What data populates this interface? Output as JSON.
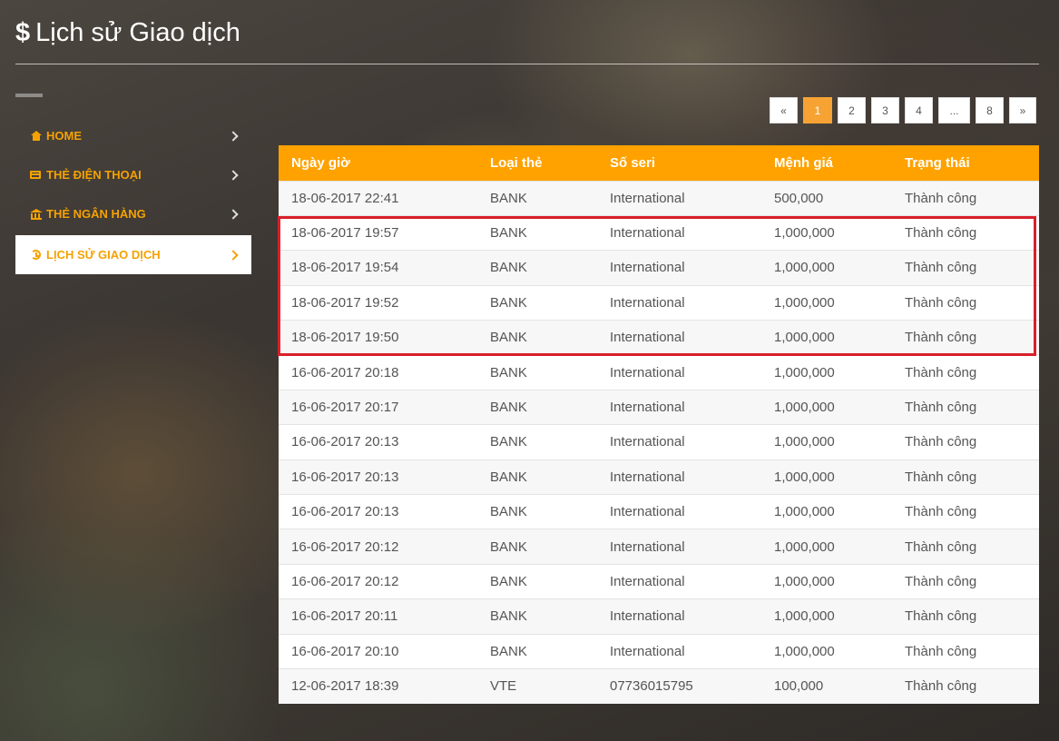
{
  "header": {
    "icon": "dollar-sign",
    "dollar": "$",
    "title": "Lịch sử Giao dịch"
  },
  "sidebar": {
    "items": [
      {
        "label": "HOME",
        "icon": "home-icon",
        "active": false
      },
      {
        "label": "THẺ ĐIỆN THOẠI",
        "icon": "credit-card-icon",
        "active": false
      },
      {
        "label": "THẺ NGÂN HÀNG",
        "icon": "bank-icon",
        "active": false
      },
      {
        "label": "LỊCH SỬ GIAO DỊCH",
        "icon": "history-icon",
        "active": true
      }
    ]
  },
  "pagination": {
    "prev": "«",
    "pages": [
      "1",
      "2",
      "3",
      "4",
      "...",
      "8"
    ],
    "next": "»",
    "current": "1"
  },
  "table": {
    "columns": [
      "Ngày giờ",
      "Loại thẻ",
      "Số seri",
      "Mệnh giá",
      "Trạng thái"
    ],
    "rows": [
      [
        "18-06-2017 22:41",
        "BANK",
        "International",
        "500,000",
        "Thành công"
      ],
      [
        "18-06-2017 19:57",
        "BANK",
        "International",
        "1,000,000",
        "Thành công"
      ],
      [
        "18-06-2017 19:54",
        "BANK",
        "International",
        "1,000,000",
        "Thành công"
      ],
      [
        "18-06-2017 19:52",
        "BANK",
        "International",
        "1,000,000",
        "Thành công"
      ],
      [
        "18-06-2017 19:50",
        "BANK",
        "International",
        "1,000,000",
        "Thành công"
      ],
      [
        "16-06-2017 20:18",
        "BANK",
        "International",
        "1,000,000",
        "Thành công"
      ],
      [
        "16-06-2017 20:17",
        "BANK",
        "International",
        "1,000,000",
        "Thành công"
      ],
      [
        "16-06-2017 20:13",
        "BANK",
        "International",
        "1,000,000",
        "Thành công"
      ],
      [
        "16-06-2017 20:13",
        "BANK",
        "International",
        "1,000,000",
        "Thành công"
      ],
      [
        "16-06-2017 20:13",
        "BANK",
        "International",
        "1,000,000",
        "Thành công"
      ],
      [
        "16-06-2017 20:12",
        "BANK",
        "International",
        "1,000,000",
        "Thành công"
      ],
      [
        "16-06-2017 20:12",
        "BANK",
        "International",
        "1,000,000",
        "Thành công"
      ],
      [
        "16-06-2017 20:11",
        "BANK",
        "International",
        "1,000,000",
        "Thành công"
      ],
      [
        "16-06-2017 20:10",
        "BANK",
        "International",
        "1,000,000",
        "Thành công"
      ],
      [
        "12-06-2017 18:39",
        "VTE",
        "07736015795",
        "100,000",
        "Thành công"
      ]
    ]
  },
  "colors": {
    "accent": "#ffa200",
    "active_page": "#f7a334",
    "highlight_border": "#d8202a"
  }
}
